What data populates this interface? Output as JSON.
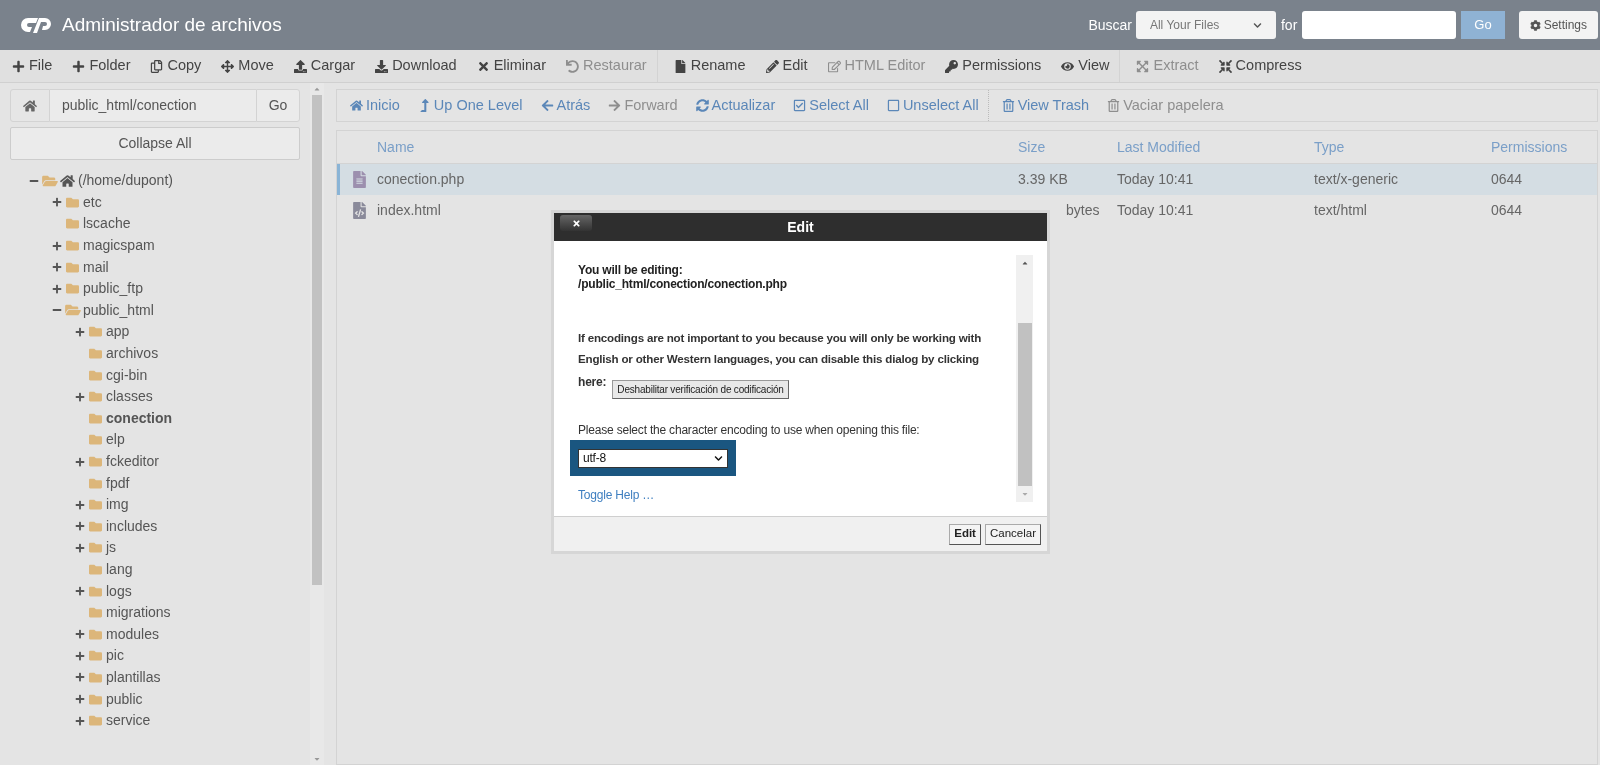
{
  "header": {
    "title": "Administrador de archivos",
    "search_label": "Buscar",
    "search_scope": "All Your Files",
    "for_label": "for",
    "go": "Go",
    "settings": "Settings"
  },
  "toolbar": [
    [
      {
        "label": "File",
        "disabled": false
      },
      {
        "label": "Folder",
        "disabled": false
      },
      {
        "label": "Copy",
        "disabled": false
      },
      {
        "label": "Move",
        "disabled": false
      },
      {
        "label": "Cargar",
        "disabled": false
      },
      {
        "label": "Download",
        "disabled": false
      },
      {
        "label": "Eliminar",
        "disabled": false
      },
      {
        "label": "Restaurar",
        "disabled": true
      }
    ],
    [
      {
        "label": "Rename",
        "disabled": false
      },
      {
        "label": "Edit",
        "disabled": false
      },
      {
        "label": "HTML Editor",
        "disabled": true
      },
      {
        "label": "Permissions",
        "disabled": false
      },
      {
        "label": "View",
        "disabled": false
      }
    ],
    [
      {
        "label": "Extract",
        "disabled": true
      },
      {
        "label": "Compress",
        "disabled": false
      }
    ]
  ],
  "sidebar": {
    "path": "public_html/conection",
    "go": "Go",
    "collapse": "Collapse All",
    "tree": [
      {
        "label": "(/home/dupont)",
        "kind": "home",
        "expanded": true,
        "selected": false,
        "children": [
          {
            "label": "etc",
            "kind": "branch",
            "expanded": false,
            "selected": false
          },
          {
            "label": "lscache",
            "kind": "leaf",
            "selected": false
          },
          {
            "label": "magicspam",
            "kind": "branch",
            "expanded": false,
            "selected": false
          },
          {
            "label": "mail",
            "kind": "branch",
            "expanded": false,
            "selected": false
          },
          {
            "label": "public_ftp",
            "kind": "branch",
            "expanded": false,
            "selected": false
          },
          {
            "label": "public_html",
            "kind": "branch",
            "expanded": true,
            "selected": false,
            "children": [
              {
                "label": "app",
                "kind": "branch",
                "expanded": false,
                "selected": false
              },
              {
                "label": "archivos",
                "kind": "leaf",
                "selected": false
              },
              {
                "label": "cgi-bin",
                "kind": "leaf",
                "selected": false
              },
              {
                "label": "classes",
                "kind": "branch",
                "expanded": false,
                "selected": false
              },
              {
                "label": "conection",
                "kind": "leaf",
                "selected": true
              },
              {
                "label": "elp",
                "kind": "leaf",
                "selected": false
              },
              {
                "label": "fckeditor",
                "kind": "branch",
                "expanded": false,
                "selected": false
              },
              {
                "label": "fpdf",
                "kind": "leaf",
                "selected": false
              },
              {
                "label": "img",
                "kind": "branch",
                "expanded": false,
                "selected": false
              },
              {
                "label": "includes",
                "kind": "branch",
                "expanded": false,
                "selected": false
              },
              {
                "label": "js",
                "kind": "branch",
                "expanded": false,
                "selected": false
              },
              {
                "label": "lang",
                "kind": "leaf",
                "selected": false
              },
              {
                "label": "logs",
                "kind": "branch",
                "expanded": false,
                "selected": false
              },
              {
                "label": "migrations",
                "kind": "leaf",
                "selected": false
              },
              {
                "label": "modules",
                "kind": "branch",
                "expanded": false,
                "selected": false
              },
              {
                "label": "pic",
                "kind": "branch",
                "expanded": false,
                "selected": false
              },
              {
                "label": "plantillas",
                "kind": "branch",
                "expanded": false,
                "selected": false
              },
              {
                "label": "public",
                "kind": "branch",
                "expanded": false,
                "selected": false
              },
              {
                "label": "service",
                "kind": "branch",
                "expanded": false,
                "selected": false
              }
            ]
          }
        ]
      }
    ]
  },
  "navbar": [
    [
      {
        "label": "Inicio",
        "disabled": false
      },
      {
        "label": "Up One Level",
        "disabled": false
      },
      {
        "label": "Atrás",
        "disabled": false
      },
      {
        "label": "Forward",
        "disabled": true
      },
      {
        "label": "Actualizar",
        "disabled": false
      },
      {
        "label": "Select All",
        "disabled": false
      },
      {
        "label": "Unselect All",
        "disabled": false
      }
    ],
    [
      {
        "label": "View Trash",
        "disabled": false
      },
      {
        "label": "Vaciar papelera",
        "disabled": true
      }
    ]
  ],
  "table": {
    "columns": [
      "Name",
      "Size",
      "Last Modified",
      "Type",
      "Permissions"
    ],
    "rows": [
      {
        "kind": "text",
        "selected": true,
        "cells": [
          "conection.php",
          "3.39 KB",
          "Today 10:41",
          "text/x-generic",
          "0644"
        ]
      },
      {
        "kind": "code",
        "selected": false,
        "cells": [
          "index.html",
          "bytes",
          "Today 10:41",
          "text/html",
          "0644"
        ]
      }
    ]
  },
  "dialog": {
    "title": "Edit",
    "heading": "You will be editing:",
    "path": "/public_html/conection/conection.php",
    "paragraph": "If encodings are not important to you because you will only be working with English or other Western languages, you can disable this dialog by clicking",
    "here": "here:",
    "disable_button": "Deshabilitar verificación de codificación",
    "encoding_label": "Please select the character encoding to use when opening this file:",
    "encoding": "utf-8",
    "help_link": "Toggle Help …",
    "buttons": [
      "Edit",
      "Cancelar"
    ]
  }
}
